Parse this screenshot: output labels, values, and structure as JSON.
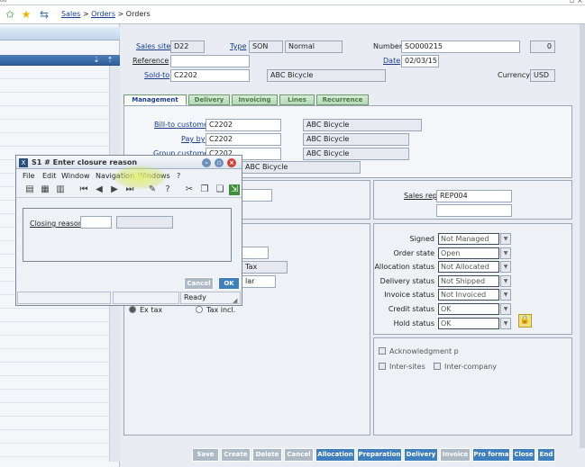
{
  "topstrip": {
    "text": "on"
  },
  "breadcrumb": {
    "sales": "Sales",
    "sep1": ">",
    "orders_link": "Orders",
    "sep2": ">",
    "current": "Orders"
  },
  "header": {
    "sales_site_label": "Sales site",
    "sales_site_value": "D22",
    "type_label": "Type",
    "type_value": "SON",
    "type_desc": "Normal",
    "number_label": "Number",
    "number_value": "SO000215",
    "number_extra": "0",
    "reference_label": "Reference",
    "reference_value": "",
    "date_label": "Date",
    "date_value": "02/03/15",
    "soldto_label": "Sold-to",
    "soldto_value": "C2202",
    "soldto_name": "ABC Bicycle",
    "currency_label": "Currency",
    "currency_value": "USD"
  },
  "tabs": [
    "Management",
    "Delivery",
    "Invoicing",
    "Lines",
    "Recurrence"
  ],
  "management": {
    "billto_label": "Bill-to customer",
    "billto_value": "C2202",
    "billto_name": "ABC Bicycle",
    "payby_label": "Pay by",
    "payby_value": "C2202",
    "payby_name": "ABC Bicycle",
    "group_label": "Group customer",
    "group_value": "C2202",
    "group_name": "ABC Bicycle",
    "extra_name": "ABC Bicycle",
    "salesrep_label": "Sales rep",
    "salesrep_value": "REP004",
    "tax_value": "Tax",
    "lar_value": "lar",
    "ex_tax_label": "Ex tax",
    "tax_incl_label": "Tax incl."
  },
  "status": [
    {
      "label": "Signed",
      "value": "Not Managed"
    },
    {
      "label": "Order state",
      "value": "Open"
    },
    {
      "label": "Allocation status",
      "value": "Not Allocated"
    },
    {
      "label": "Delivery status",
      "value": "Not Shipped"
    },
    {
      "label": "Invoice status",
      "value": "Not Invoiced"
    },
    {
      "label": "Credit status",
      "value": "OK"
    },
    {
      "label": "Hold status",
      "value": "OK"
    }
  ],
  "checks": {
    "ack": "Acknowledgment p",
    "intersites": "Inter-sites",
    "intercompany": "Inter-company"
  },
  "buttons": [
    "Save",
    "Create",
    "Delete",
    "Cancel",
    "Allocation",
    "Preparation",
    "Delivery",
    "Invoice",
    "Pro forma",
    "Close",
    "End"
  ],
  "dialog": {
    "title": "S1 # Enter closure reason",
    "menu": [
      "File",
      "Edit",
      "Window",
      "Navigation",
      "Windows",
      "?"
    ],
    "closing_label": "Closing reason",
    "cancel": "Cancel",
    "ok": "OK",
    "status": "Ready"
  },
  "colors": {
    "accent": "#3f7fbd",
    "tab_green": "#6c9a6c",
    "link": "#1a3d8f"
  }
}
